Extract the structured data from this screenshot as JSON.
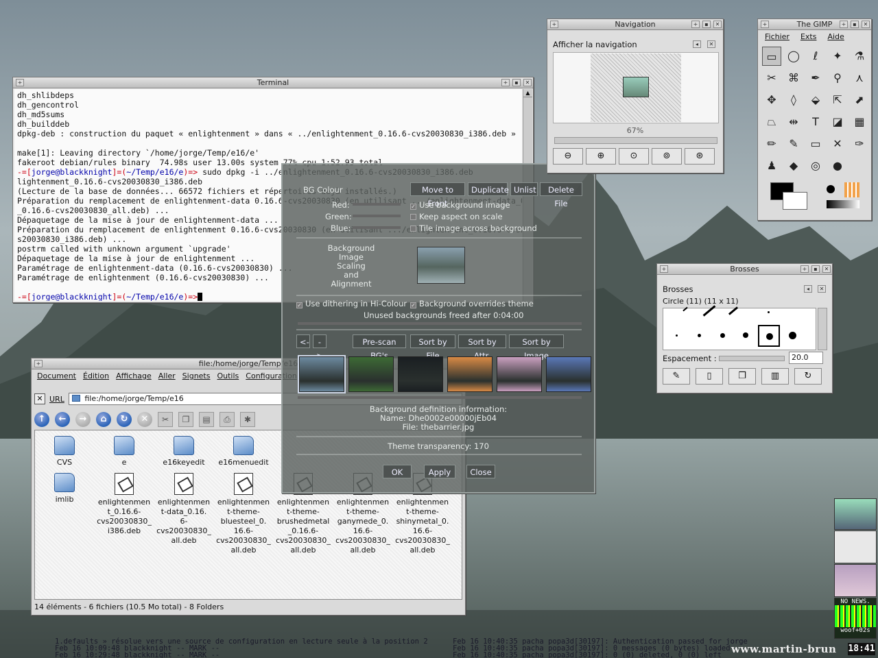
{
  "terminal": {
    "title": "Terminal",
    "lines": [
      {
        "t": "dh_shlibdeps"
      },
      {
        "t": "dh_gencontrol"
      },
      {
        "t": "dh_md5sums"
      },
      {
        "t": "dh_builddeb"
      },
      {
        "t": "dpkg-deb : construction du paquet « enlightenment » dans « ../enlightenment_0.16.6-cvs20030830_i386.deb »"
      },
      {
        "t": ""
      },
      {
        "t": "make[1]: Leaving directory `/home/jorge/Temp/e16/e'"
      },
      {
        "t": "fakeroot debian/rules binary  74.98s user 13.00s system 77% cpu 1:52.93 total"
      },
      {
        "p1": "-=[",
        "user": "jorge@blackknight",
        "p2": "]=(",
        "dir": "~/Temp/e16/e",
        "p3": ")=>",
        "t": " sudo dpkg -i ../enlightenment_0.16.6-cvs20030830_i386.deb"
      },
      {
        "t": "lightenment_0.16.6-cvs20030830_i386.deb"
      },
      {
        "t": "(Lecture de la base de données... 66572 fichiers et répertoires déjà installés.)"
      },
      {
        "t": "Préparation du remplacement de enlightenment-data 0.16.6-cvs20030830 (en utilisant .../enlightenment-data_0.16.6-cvs20030830"
      },
      {
        "t": "_0.16.6-cvs20030830_all.deb) ..."
      },
      {
        "t": "Dépaquetage de la mise à jour de enlightenment-data ..."
      },
      {
        "t": "Préparation du remplacement de enlightenment 0.16.6-cvs20030830 (en utilisant .../enlightenment_0.16.6-cvs20030830_i386.deb"
      },
      {
        "t": "s20030830_i386.deb) ..."
      },
      {
        "t": "postrm called with unknown argument `upgrade'"
      },
      {
        "t": "Dépaquetage de la mise à jour de enlightenment ..."
      },
      {
        "t": "Paramétrage de enlightenment-data (0.16.6-cvs20030830) ..."
      },
      {
        "t": "Paramétrage de enlightenment (0.16.6-cvs20030830) ..."
      },
      {
        "t": ""
      },
      {
        "p1": "-=[",
        "user": "jorge@blackknight",
        "p2": "]=(",
        "dir": "~/Temp/e16/e",
        "p3": ")=>",
        "t": ""
      }
    ]
  },
  "konqueror": {
    "title": "file:/home/jorge/Temp/e16",
    "menu": [
      "Document",
      "Édition",
      "Affichage",
      "Aller",
      "Signets",
      "Outils",
      "Configuration"
    ],
    "url_label": "URL",
    "url_value": "file:/home/jorge/Temp/e16",
    "folders": [
      "CVS",
      "e",
      "e16keyedit",
      "e16menuedit",
      "imlib"
    ],
    "files": [
      "enlightenmen\nt_0.16.6-\ncvs20030830_\ni386.deb",
      "enlightenmen\nt-data_0.16.\n6-\ncvs20030830_\nall.deb",
      "enlightenmen\nt-theme-\nbluesteel_0.\n16.6-\ncvs20030830_\nall.deb",
      "enlightenmen\nt-theme-\nbrushedmetal\n_0.16.6-\ncvs20030830_\nall.deb",
      "enlightenmen\nt-theme-\nganymede_0.\n16.6-\ncvs20030830_\nall.deb",
      "enlightenmen\nt-theme-\nshinymetal_0.\n16.6-\ncvs20030830_\nall.deb"
    ],
    "status": "14 éléments - 6 fichiers (10.5 Mo total) - 8 Folders"
  },
  "bgdialog": {
    "bg_colour": "BG Colour",
    "buttons_top": [
      "Move to Front",
      "Duplicate",
      "Unlist",
      "Delete File"
    ],
    "red": "Red:",
    "green": "Green:",
    "blue": "Blue:",
    "opt_use_bg_image": "Use background image",
    "opt_keep_aspect": "Keep aspect on scale",
    "opt_tile": "Tile image across background",
    "bg_image_label": "Background\nImage\nScaling\nand\nAlignment",
    "opt_dither": "Use dithering in Hi-Colour",
    "opt_override": "Background overrides theme",
    "unused_freed": "Unused backgrounds freed after 0:04:00",
    "nav_prev": "<-",
    "nav_next": "->",
    "prescan": "Pre-scan BG's",
    "sort_file": "Sort by File",
    "sort_attr": "Sort by Attr.",
    "sort_image": "Sort by Image",
    "info_title": "Background definition information:",
    "info_name": "Name:  Dhe0002e00000jEb04",
    "info_file": "File: thebarrier.jpg",
    "theme_transparency": "Theme transparency: 170",
    "ok": "OK",
    "apply": "Apply",
    "close": "Close",
    "thumb_colors": [
      "#6d8aa0",
      "#3d6a35",
      "#1a1f22",
      "#d98a45",
      "#caa0c0",
      "#5a78b8"
    ]
  },
  "navigation": {
    "title": "Navigation",
    "header": "Afficher la navigation",
    "zoom": "67%"
  },
  "gimp": {
    "title": "The GIMP",
    "menu": [
      "Fichier",
      "Exts",
      "Aide"
    ],
    "tools": [
      "▭",
      "◯",
      "ℓ",
      "✦",
      "⚗",
      "✂",
      "⌘",
      "✒",
      "⚲",
      "⋏",
      "✥",
      "◊",
      "⬙",
      "⇱",
      "⬈",
      "⏢",
      "⇹",
      "T",
      "◪",
      "▦",
      "✏",
      "✎",
      "▭",
      "✕",
      "✑",
      "♟",
      "◆",
      "◎",
      "●"
    ],
    "fg_color": "#000000",
    "bg_color": "#ffffff"
  },
  "brushes": {
    "title": "Brosses",
    "header": "Brosses",
    "brush_name": "Circle (11) (11 x 11)",
    "spacing_label": "Espacement :",
    "spacing_value": "20.0"
  },
  "pager": {
    "news": "NO NEWS.",
    "woof": "woof+02s",
    "clock": "18:41"
  },
  "logs": {
    "left_1": "1.defaults » résolue vers une source de configuration en lecture seule à la position 2",
    "left_2": "Feb 16 10:09:48 blackknight -- MARK --",
    "left_3": "Feb 16 10:29:48 blackknight -- MARK --",
    "right_1": "Feb 16 10:40:35 pacha popa3d[30197]: Authentication passed for jorge",
    "right_2": "Feb 16 10:40:35 pacha popa3d[30197]: 0 messages (0 bytes) loaded",
    "right_3": "Feb 16 10:40:35 pacha popa3d[30197]: 0 (0) deleted, 0 (0) left",
    "watermark": "www.martin-brun"
  }
}
